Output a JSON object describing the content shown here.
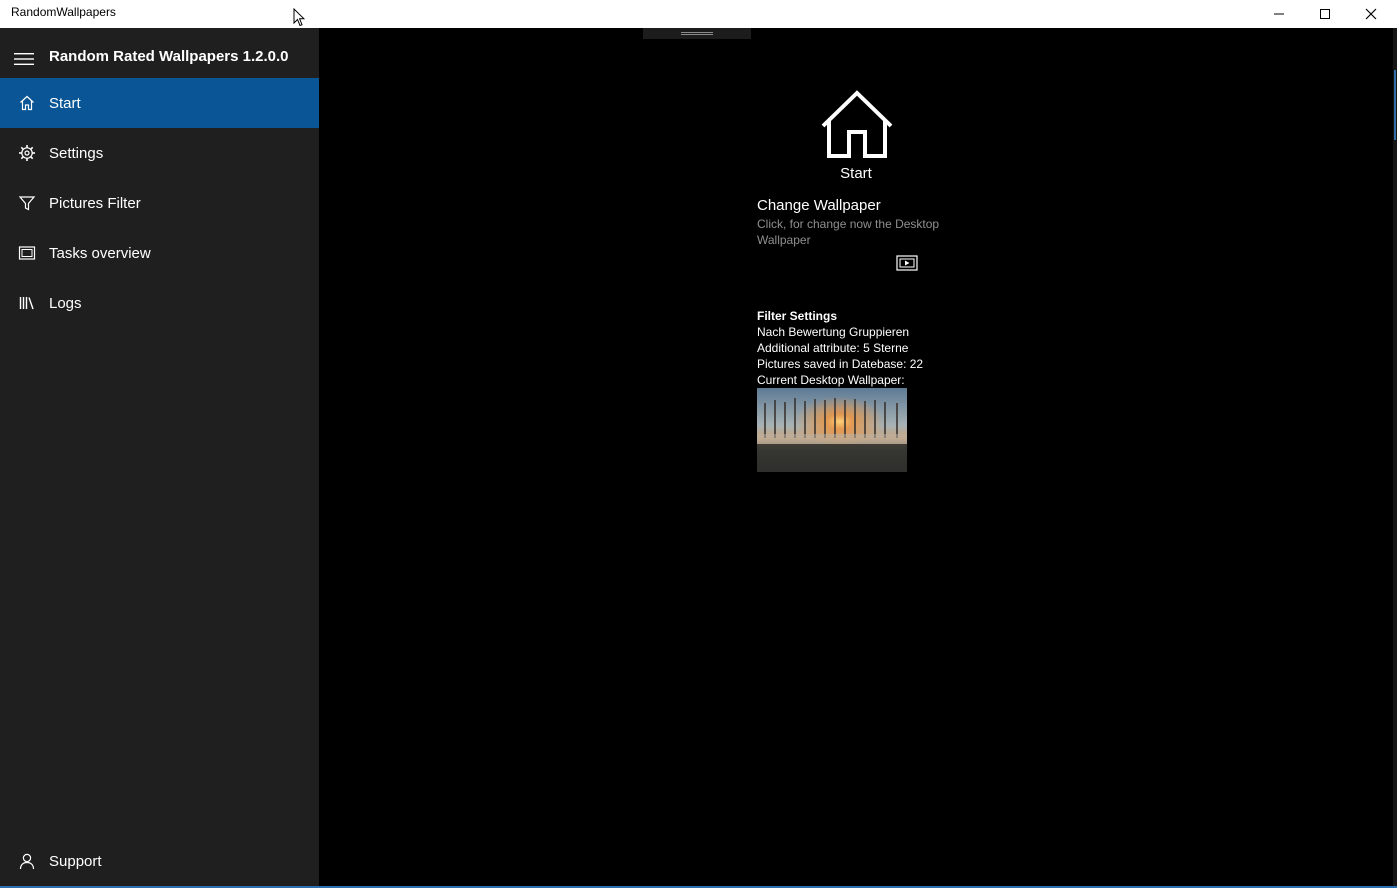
{
  "window": {
    "title": "RandomWallpapers",
    "controls": [
      "minimize-icon",
      "maximize-icon",
      "close-icon"
    ]
  },
  "nav": {
    "app_title": "Random Rated Wallpapers 1.2.0.0",
    "items": [
      {
        "label": "Start",
        "icon": "home-icon",
        "selected": true
      },
      {
        "label": "Settings",
        "icon": "gear-icon"
      },
      {
        "label": "Pictures Filter",
        "icon": "filter-icon"
      },
      {
        "label": "Tasks overview",
        "icon": "tasks-icon"
      },
      {
        "label": "Logs",
        "icon": "library-icon"
      }
    ],
    "footer": {
      "label": "Support",
      "icon": "person-icon"
    }
  },
  "content": {
    "hero_label": "Start",
    "change_wallpaper": {
      "title": "Change Wallpaper",
      "description": "Click, for change now the Desktop Wallpaper"
    },
    "filter_settings": {
      "heading": "Filter Settings",
      "group": "Nach Bewertung Gruppieren",
      "attribute": "Additional attribute: 5 Sterne",
      "count": "Pictures saved in Datebase: 22",
      "current": "Current Desktop Wallpaper:"
    }
  },
  "colors": {
    "accent": "#0a5595",
    "pane_bg": "#1f1f1f",
    "content_bg": "#000000"
  }
}
